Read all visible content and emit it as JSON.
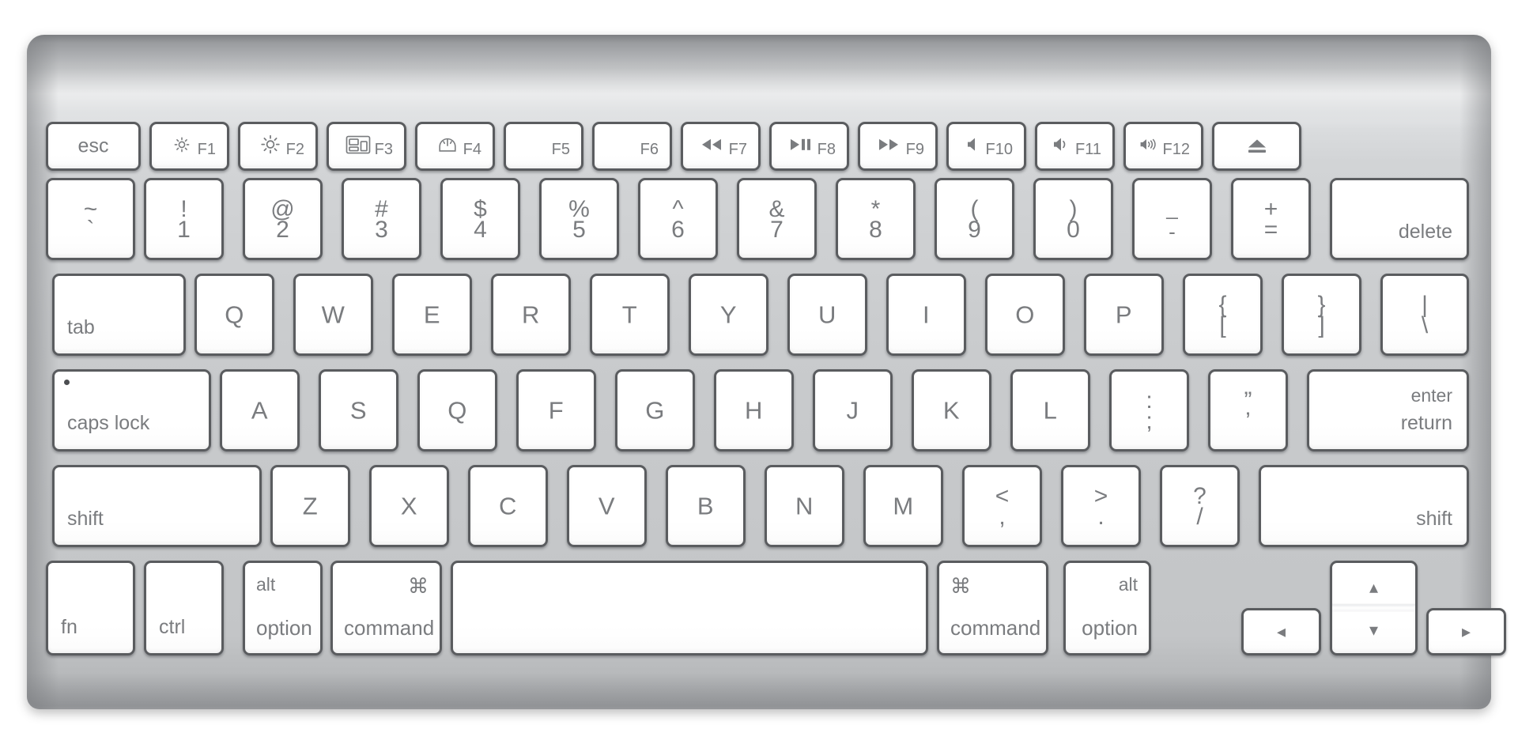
{
  "device": {
    "name": "Apple Wireless Keyboard",
    "layout": "US English (ANSI, compact)",
    "body_color": "#cbcdcf",
    "key_face_color": "#ffffff",
    "key_border_color": "#5a5c5f",
    "legend_color": "#7a7c7f"
  },
  "rows": {
    "function_row": {
      "keys": [
        {
          "id": "esc",
          "label": "esc",
          "icon": "",
          "fkey": ""
        },
        {
          "id": "f1",
          "label": "",
          "icon": "brightness-down-icon",
          "fkey": "F1"
        },
        {
          "id": "f2",
          "label": "",
          "icon": "brightness-up-icon",
          "fkey": "F2"
        },
        {
          "id": "f3",
          "label": "",
          "icon": "mission-control-icon",
          "fkey": "F3"
        },
        {
          "id": "f4",
          "label": "",
          "icon": "dashboard-icon",
          "fkey": "F4"
        },
        {
          "id": "f5",
          "label": "",
          "icon": "",
          "fkey": "F5"
        },
        {
          "id": "f6",
          "label": "",
          "icon": "",
          "fkey": "F6"
        },
        {
          "id": "f7",
          "label": "",
          "icon": "rewind-icon",
          "fkey": "F7"
        },
        {
          "id": "f8",
          "label": "",
          "icon": "play-pause-icon",
          "fkey": "F8"
        },
        {
          "id": "f9",
          "label": "",
          "icon": "fast-forward-icon",
          "fkey": "F9"
        },
        {
          "id": "f10",
          "label": "",
          "icon": "volume-mute-icon",
          "fkey": "F10"
        },
        {
          "id": "f11",
          "label": "",
          "icon": "volume-down-icon",
          "fkey": "F11"
        },
        {
          "id": "f12",
          "label": "",
          "icon": "volume-up-icon",
          "fkey": "F12"
        },
        {
          "id": "eject",
          "label": "",
          "icon": "eject-icon",
          "fkey": ""
        }
      ]
    },
    "number_row": {
      "keys": [
        {
          "id": "backtick",
          "top": "~",
          "bottom": "`"
        },
        {
          "id": "digit-1",
          "top": "!",
          "bottom": "1"
        },
        {
          "id": "digit-2",
          "top": "@",
          "bottom": "2"
        },
        {
          "id": "digit-3",
          "top": "#",
          "bottom": "3"
        },
        {
          "id": "digit-4",
          "top": "$",
          "bottom": "4"
        },
        {
          "id": "digit-5",
          "top": "%",
          "bottom": "5"
        },
        {
          "id": "digit-6",
          "top": "^",
          "bottom": "6"
        },
        {
          "id": "digit-7",
          "top": "&",
          "bottom": "7"
        },
        {
          "id": "digit-8",
          "top": "*",
          "bottom": "8"
        },
        {
          "id": "digit-9",
          "top": "(",
          "bottom": "9"
        },
        {
          "id": "digit-0",
          "top": ")",
          "bottom": "0"
        },
        {
          "id": "minus",
          "top": "_",
          "bottom": "-"
        },
        {
          "id": "equal",
          "top": "+",
          "bottom": "="
        },
        {
          "id": "delete",
          "word": "delete"
        }
      ]
    },
    "top_letter_row": {
      "keys": [
        {
          "id": "tab",
          "word": "tab"
        },
        {
          "id": "key-q",
          "letter": "Q"
        },
        {
          "id": "key-w",
          "letter": "W"
        },
        {
          "id": "key-e",
          "letter": "E"
        },
        {
          "id": "key-r",
          "letter": "R"
        },
        {
          "id": "key-t",
          "letter": "T"
        },
        {
          "id": "key-y",
          "letter": "Y"
        },
        {
          "id": "key-u",
          "letter": "U"
        },
        {
          "id": "key-i",
          "letter": "I"
        },
        {
          "id": "key-o",
          "letter": "O"
        },
        {
          "id": "key-p",
          "letter": "P"
        },
        {
          "id": "bracket-left",
          "top": "{",
          "bottom": "["
        },
        {
          "id": "bracket-right",
          "top": "}",
          "bottom": "]"
        },
        {
          "id": "backslash",
          "top": "|",
          "bottom": "\\"
        }
      ]
    },
    "home_row": {
      "keys": [
        {
          "id": "caps-lock",
          "word": "caps lock",
          "indicator": true
        },
        {
          "id": "key-a",
          "letter": "A"
        },
        {
          "id": "key-s",
          "letter": "S"
        },
        {
          "id": "key-q2",
          "letter": "Q"
        },
        {
          "id": "key-f",
          "letter": "F"
        },
        {
          "id": "key-g",
          "letter": "G"
        },
        {
          "id": "key-h",
          "letter": "H"
        },
        {
          "id": "key-j",
          "letter": "J"
        },
        {
          "id": "key-k",
          "letter": "K"
        },
        {
          "id": "key-l",
          "letter": "L"
        },
        {
          "id": "semicolon",
          "top": ":",
          "bottom": ";"
        },
        {
          "id": "quote",
          "top": "”",
          "bottom": "’"
        },
        {
          "id": "return",
          "word_top": "enter",
          "word_bottom": "return"
        }
      ]
    },
    "shift_row": {
      "keys": [
        {
          "id": "shift-left",
          "word": "shift"
        },
        {
          "id": "key-z",
          "letter": "Z"
        },
        {
          "id": "key-x",
          "letter": "X"
        },
        {
          "id": "key-c",
          "letter": "C"
        },
        {
          "id": "key-v",
          "letter": "V"
        },
        {
          "id": "key-b",
          "letter": "B"
        },
        {
          "id": "key-n",
          "letter": "N"
        },
        {
          "id": "key-m",
          "letter": "M"
        },
        {
          "id": "comma",
          "top": "<",
          "bottom": ","
        },
        {
          "id": "period",
          "top": ">",
          "bottom": "."
        },
        {
          "id": "slash",
          "top": "?",
          "bottom": "/"
        },
        {
          "id": "shift-right",
          "word": "shift"
        }
      ]
    },
    "bottom_row": {
      "keys": [
        {
          "id": "fn",
          "word": "fn"
        },
        {
          "id": "ctrl",
          "word": "ctrl"
        },
        {
          "id": "option-left",
          "top_word": "alt",
          "bottom_word": "option"
        },
        {
          "id": "command-left",
          "top_word": "⌘",
          "bottom_word": "command"
        },
        {
          "id": "space",
          "word": ""
        },
        {
          "id": "command-right",
          "top_word": "⌘",
          "bottom_word": "command"
        },
        {
          "id": "option-right",
          "top_word": "alt",
          "bottom_word": "option"
        },
        {
          "id": "arrow-left",
          "glyph": "◂"
        },
        {
          "id": "arrow-up",
          "glyph": "▴"
        },
        {
          "id": "arrow-down",
          "glyph": "▾"
        },
        {
          "id": "arrow-right",
          "glyph": "▸"
        }
      ]
    }
  }
}
